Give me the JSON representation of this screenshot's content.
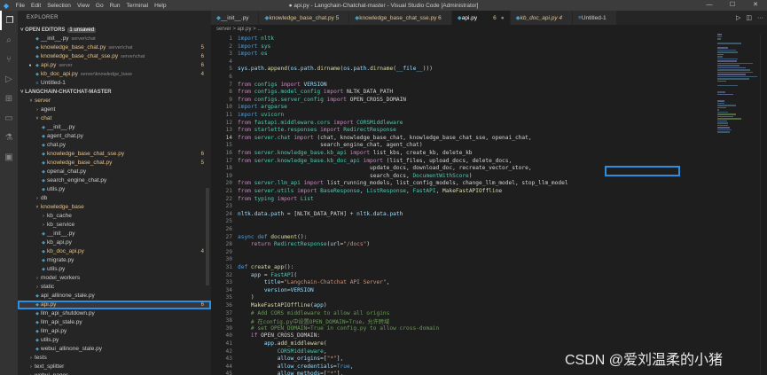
{
  "window": {
    "title": "● api.py - Langchain-Chatchat-master - Visual Studio Code [Administrator]",
    "menu": [
      "File",
      "Edit",
      "Selection",
      "View",
      "Go",
      "Run",
      "Terminal",
      "Help"
    ]
  },
  "sidebar": {
    "header": "EXPLORER",
    "open_editors": {
      "label": "OPEN EDITORS",
      "badge": "1 unsaved",
      "items": [
        {
          "name": "__init__.py",
          "path": "server\\chat",
          "count": "",
          "color": "#cccccc"
        },
        {
          "name": "knowledge_base_chat.py",
          "path": "server\\chat",
          "count": "5",
          "color": "#e2c08d"
        },
        {
          "name": "knowledge_base_chat_sse.py",
          "path": "server\\chat",
          "count": "6",
          "color": "#e2c08d"
        },
        {
          "name": "api.py",
          "path": "server",
          "count": "6",
          "color": "#e2c08d"
        },
        {
          "name": "kb_doc_api.py",
          "path": "server\\knowledge_base",
          "count": "4",
          "color": "#e2c08d"
        },
        {
          "name": "Untitled-1",
          "path": "",
          "count": "",
          "color": "#cccccc"
        }
      ]
    },
    "project": {
      "label": "LANGCHAIN-CHATCHAT-MASTER",
      "tree": [
        {
          "label": "server",
          "indent": 1,
          "kind": "folder",
          "open": true,
          "color": "#e2c08d",
          "count": ""
        },
        {
          "label": "agent",
          "indent": 2,
          "kind": "folder",
          "open": false,
          "color": "#cccccc",
          "count": ""
        },
        {
          "label": "chat",
          "indent": 2,
          "kind": "folder",
          "open": true,
          "color": "#e2c08d",
          "count": ""
        },
        {
          "label": "__init__.py",
          "indent": 3,
          "kind": "file",
          "color": "#cccccc",
          "count": ""
        },
        {
          "label": "agent_chat.py",
          "indent": 3,
          "kind": "file",
          "color": "#cccccc",
          "count": ""
        },
        {
          "label": "chat.py",
          "indent": 3,
          "kind": "file",
          "color": "#cccccc",
          "count": ""
        },
        {
          "label": "knowledge_base_chat_sse.py",
          "indent": 3,
          "kind": "file",
          "color": "#e2c08d",
          "count": "6"
        },
        {
          "label": "knowledge_base_chat.py",
          "indent": 3,
          "kind": "file",
          "color": "#e2c08d",
          "count": "5"
        },
        {
          "label": "openai_chat.py",
          "indent": 3,
          "kind": "file",
          "color": "#cccccc",
          "count": ""
        },
        {
          "label": "search_engine_chat.py",
          "indent": 3,
          "kind": "file",
          "color": "#cccccc",
          "count": ""
        },
        {
          "label": "utils.py",
          "indent": 3,
          "kind": "file",
          "color": "#cccccc",
          "count": ""
        },
        {
          "label": "db",
          "indent": 2,
          "kind": "folder",
          "open": false,
          "color": "#cccccc",
          "count": ""
        },
        {
          "label": "knowledge_base",
          "indent": 2,
          "kind": "folder",
          "open": true,
          "color": "#e2c08d",
          "count": ""
        },
        {
          "label": "kb_cache",
          "indent": 3,
          "kind": "folder",
          "open": false,
          "color": "#cccccc",
          "count": ""
        },
        {
          "label": "kb_service",
          "indent": 3,
          "kind": "folder",
          "open": false,
          "color": "#cccccc",
          "count": ""
        },
        {
          "label": "__init__.py",
          "indent": 3,
          "kind": "file",
          "color": "#cccccc",
          "count": ""
        },
        {
          "label": "kb_api.py",
          "indent": 3,
          "kind": "file",
          "color": "#cccccc",
          "count": ""
        },
        {
          "label": "kb_doc_api.py",
          "indent": 3,
          "kind": "file",
          "color": "#e2c08d",
          "count": "4"
        },
        {
          "label": "migrate.py",
          "indent": 3,
          "kind": "file",
          "color": "#cccccc",
          "count": ""
        },
        {
          "label": "utils.py",
          "indent": 3,
          "kind": "file",
          "color": "#cccccc",
          "count": ""
        },
        {
          "label": "model_workers",
          "indent": 2,
          "kind": "folder",
          "open": false,
          "color": "#cccccc",
          "count": ""
        },
        {
          "label": "static",
          "indent": 2,
          "kind": "folder",
          "open": false,
          "color": "#cccccc",
          "count": ""
        },
        {
          "label": "api_allinone_stale.py",
          "indent": 2,
          "kind": "file",
          "color": "#cccccc",
          "count": ""
        },
        {
          "label": "api.py",
          "indent": 2,
          "kind": "file",
          "color": "#e2c08d",
          "count": "6",
          "selected": true
        },
        {
          "label": "llm_api_shutdown.py",
          "indent": 2,
          "kind": "file",
          "color": "#cccccc",
          "count": ""
        },
        {
          "label": "llm_api_stale.py",
          "indent": 2,
          "kind": "file",
          "color": "#cccccc",
          "count": ""
        },
        {
          "label": "llm_api.py",
          "indent": 2,
          "kind": "file",
          "color": "#cccccc",
          "count": ""
        },
        {
          "label": "utils.py",
          "indent": 2,
          "kind": "file",
          "color": "#cccccc",
          "count": ""
        },
        {
          "label": "webui_allinone_stale.py",
          "indent": 2,
          "kind": "file",
          "color": "#cccccc",
          "count": ""
        },
        {
          "label": "tests",
          "indent": 1,
          "kind": "folder",
          "open": false,
          "color": "#cccccc",
          "count": ""
        },
        {
          "label": "text_splitter",
          "indent": 1,
          "kind": "folder",
          "open": false,
          "color": "#cccccc",
          "count": ""
        },
        {
          "label": "webui_pages",
          "indent": 1,
          "kind": "folder",
          "open": false,
          "color": "#cccccc",
          "count": ""
        }
      ]
    }
  },
  "tabs": [
    {
      "label": "__init__.py",
      "active": false,
      "color": "#cccccc"
    },
    {
      "label": "knowledge_base_chat.py 5",
      "active": false,
      "color": "#e2c08d"
    },
    {
      "label": "knowledge_base_chat_sse.py 6",
      "active": false,
      "color": "#e2c08d"
    },
    {
      "label": "api.py",
      "active": true,
      "color": "#e2c08d",
      "suffix": "6"
    },
    {
      "label": "kb_doc_api.py 4",
      "active": false,
      "color": "#e2c08d"
    },
    {
      "label": "Untitled-1",
      "active": false,
      "color": "#cccccc"
    }
  ],
  "breadcrumb": "server > api.py > ...",
  "code": {
    "start_line": 1,
    "lines": [
      "<span class='k'>import</span> <span class='t'>nltk</span>",
      "<span class='k'>import</span> <span class='t'>sys</span>",
      "<span class='k'>import</span> <span class='t'>os</span>",
      "",
      "<span class='v'>sys</span>.<span class='v'>path</span>.<span class='f'>append</span>(<span class='v'>os</span>.<span class='v'>path</span>.<span class='f'>dirname</span>(<span class='v'>os</span>.<span class='v'>path</span>.<span class='f'>dirname</span>(<span class='v'>__file__</span>)))",
      "",
      "<span class='kc'>from</span> <span class='t'>configs</span> <span class='kc'>import</span> <span class='v'>VERSION</span>",
      "<span class='kc'>from</span> <span class='t'>configs.model_config</span> <span class='kc'>import</span> NLTK_DATA_PATH",
      "<span class='kc'>from</span> <span class='t'>configs.server_config</span> <span class='kc'>import</span> OPEN_CROSS_DOMAIN",
      "<span class='k'>import</span> <span class='t'>argparse</span>",
      "<span class='k'>import</span> <span class='t'>uvicorn</span>",
      "<span class='kc'>from</span> <span class='t'>fastapi.middleware.cors</span> <span class='kc'>import</span> <span class='t'>CORSMiddleware</span>",
      "<span class='kc'>from</span> <span class='t'>starlette.responses</span> <span class='kc'>import</span> <span class='t'>RedirectResponse</span>",
      "<span class='kc'>from</span> <span class='t'>server.chat</span> <span class='kc'>import</span> (chat, knowledge_base_chat, knowledge_base_chat_sse, openai_chat,",
      "                         search_engine_chat, agent_chat)",
      "<span class='kc'>from</span> <span class='t'>server.knowledge_base.kb_api</span> <span class='kc'>import</span> list_kbs, create_kb, delete_kb",
      "<span class='kc'>from</span> <span class='t'>server.knowledge_base.kb_doc_api</span> <span class='kc'>import</span> (list_files, upload_docs, delete_docs,",
      "                                        update_docs, download_doc, recreate_vector_store,",
      "                                        search_docs, <span class='t'>DocumentWithScore</span>)",
      "<span class='kc'>from</span> <span class='t'>server.llm_api</span> <span class='kc'>import</span> list_running_models, list_config_models, change_llm_model, stop_llm_model",
      "<span class='kc'>from</span> <span class='t'>server.utils</span> <span class='kc'>import</span> <span class='t'>BaseResponse</span>, <span class='t'>ListResponse</span>, <span class='t'>FastAPI</span>, <span class='f'>MakeFastAPIOffline</span>",
      "<span class='kc'>from</span> <span class='t'>typing</span> <span class='kc'>import</span> <span class='t'>List</span>",
      "",
      "<span class='v'>nltk</span>.<span class='v'>data</span>.<span class='v'>path</span> = [NLTK_DATA_PATH] + <span class='v'>nltk</span>.<span class='v'>data</span>.<span class='v'>path</span>",
      "",
      "",
      "<span class='k'>async</span> <span class='k'>def</span> <span class='f'>document</span>():",
      "    <span class='kc'>return</span> <span class='t'>RedirectResponse</span>(<span class='v'>url</span>=<span class='s'>\"/docs\"</span>)",
      "",
      "",
      "<span class='k'>def</span> <span class='f'>create_app</span>():",
      "    <span class='v'>app</span> = <span class='t'>FastAPI</span>(",
      "        <span class='v'>title</span>=<span class='s'>\"Langchain-Chatchat API Server\"</span>,",
      "        <span class='v'>version</span>=<span class='v'>VERSION</span>",
      "    )",
      "    <span class='f'>MakeFastAPIOffline</span>(<span class='v'>app</span>)",
      "    <span class='c'># Add CORS middleware to allow all origins</span>",
      "    <span class='c'># 在config.py中设置OPEN_DOMAIN=True，允许跨域</span>",
      "    <span class='c'># set OPEN_DOMAIN=True in config.py to allow cross-domain</span>",
      "    <span class='kc'>if</span> OPEN_CROSS_DOMAIN:",
      "        <span class='v'>app</span>.<span class='f'>add_middleware</span>(",
      "            <span class='t'>CORSMiddleware</span>,",
      "            <span class='v'>allow_origins</span>=[<span class='s'>\"*\"</span>],",
      "            <span class='v'>allow_credentials</span>=<span class='k'>True</span>,",
      "            <span class='v'>allow_methods</span>=[<span class='s'>\"*\"</span>],"
    ]
  },
  "watermark": "CSDN @爱刘温柔的小猪"
}
